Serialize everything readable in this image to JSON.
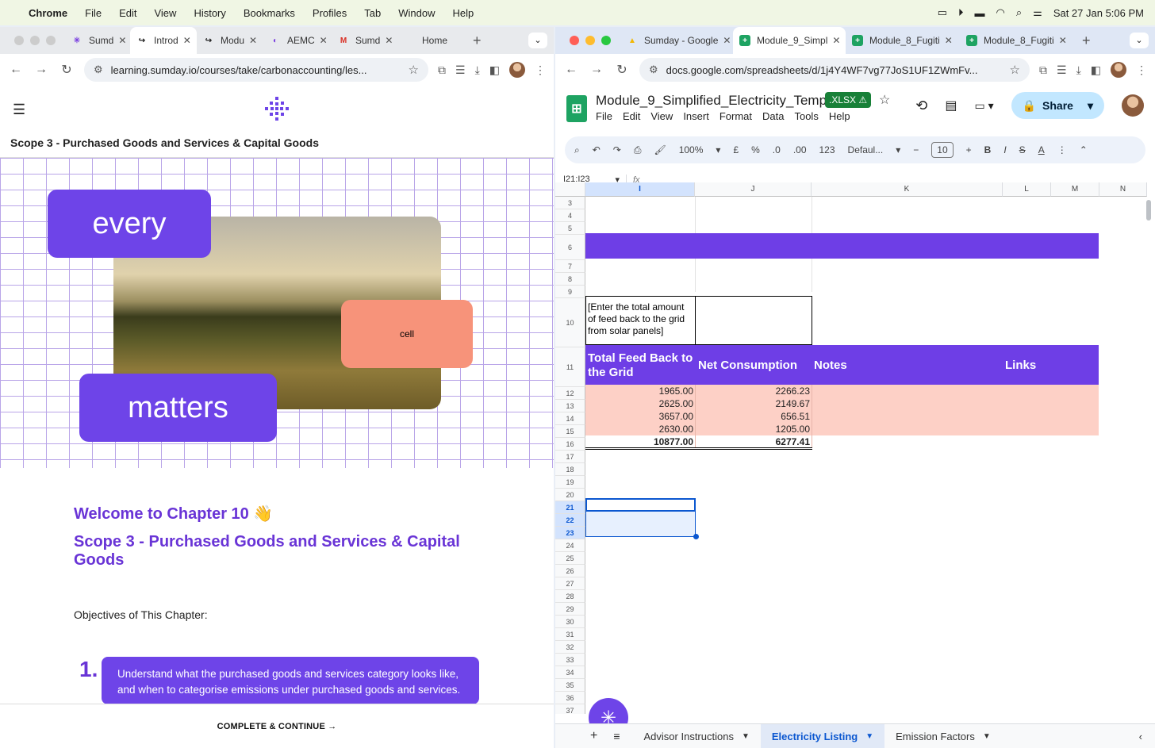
{
  "menubar": {
    "apple": "",
    "items": [
      "Chrome",
      "File",
      "Edit",
      "View",
      "History",
      "Bookmarks",
      "Profiles",
      "Tab",
      "Window",
      "Help"
    ],
    "datetime": "Sat 27 Jan  5:06 PM"
  },
  "left": {
    "tabs": [
      {
        "label": "Sumd",
        "fav": "✳",
        "color": "#7a3fe0"
      },
      {
        "label": "Introd",
        "fav": "↪",
        "color": "#222",
        "active": true
      },
      {
        "label": "Modu",
        "fav": "↪",
        "color": "#222"
      },
      {
        "label": "AEMC",
        "fav": "◐",
        "color": "#7a3fe0"
      },
      {
        "label": "Sumd",
        "fav": "M",
        "color": "#d93025"
      },
      {
        "label": "Home",
        "fav": "",
        "color": "#999"
      }
    ],
    "url": "learning.sumday.io/courses/take/carbonaccounting/les...",
    "page": {
      "scope_title": "Scope 3 - Purchased Goods and Services & Capital Goods",
      "hero_words": {
        "every": "every",
        "cell": "cell",
        "matters": "matters"
      },
      "welcome": "Welcome to Chapter 10 👋",
      "chapter_title": "Scope 3 - Purchased Goods and Services & Capital Goods",
      "objectives_label": "Objectives of This Chapter:",
      "objective_num": "1.",
      "objective_text": "Understand what the purchased goods and services category looks like, and when to categorise emissions under purchased goods and services.",
      "footer_btn": "COMPLETE & CONTINUE  →"
    }
  },
  "right": {
    "tabs": [
      {
        "label": "Sumday - Google",
        "fav": "▲",
        "color": "#f2b705"
      },
      {
        "label": "Module_9_Simpl",
        "fav": "+",
        "color": "#1ea362",
        "active": true
      },
      {
        "label": "Module_8_Fugiti",
        "fav": "+",
        "color": "#1ea362"
      },
      {
        "label": "Module_8_Fugiti",
        "fav": "+",
        "color": "#1ea362"
      }
    ],
    "url": "docs.google.com/spreadsheets/d/1j4Y4WF7vg77JoS1UF1ZWmFv...",
    "doc_title": "Module_9_Simplified_Electricity_Templ...",
    "badge": ".XLSX ⚠",
    "menus": [
      "File",
      "Edit",
      "View",
      "Insert",
      "Format",
      "Data",
      "Tools",
      "Help"
    ],
    "share": "Share",
    "toolbar": {
      "zoom": "100%",
      "currency": "£",
      "percent": "%",
      "dec_down": ".0",
      "dec_up": ".00",
      "num": "123",
      "font": "Defaul...",
      "font_size": "10"
    },
    "name_box": "I21:I23",
    "columns": [
      "I",
      "J",
      "K",
      "L",
      "M",
      "N"
    ],
    "rows": [
      "3",
      "4",
      "5",
      "6",
      "7",
      "8",
      "9",
      "10",
      "11",
      "12",
      "13",
      "14",
      "15",
      "16",
      "17",
      "18",
      "19",
      "20",
      "21",
      "22",
      "23",
      "24",
      "25",
      "26",
      "27",
      "28",
      "29",
      "30",
      "31",
      "32",
      "33",
      "34",
      "35",
      "36",
      "37"
    ],
    "note_cell": "[Enter the total amount of feed back to the grid from solar panels]",
    "headers": {
      "feedback": "Total Feed Back to the Grid",
      "net": "Net Consumption",
      "notes": "Notes",
      "links": "Links"
    },
    "table": [
      {
        "feedback": "1965.00",
        "net": "2266.23"
      },
      {
        "feedback": "2625.00",
        "net": "2149.67"
      },
      {
        "feedback": "3657.00",
        "net": "656.51"
      },
      {
        "feedback": "2630.00",
        "net": "1205.00"
      }
    ],
    "totals": {
      "feedback": "10877.00",
      "net": "6277.41"
    },
    "sheet_tabs": [
      {
        "label": "Advisor Instructions"
      },
      {
        "label": "Electricity Listing",
        "active": true
      },
      {
        "label": "Emission Factors"
      }
    ]
  }
}
